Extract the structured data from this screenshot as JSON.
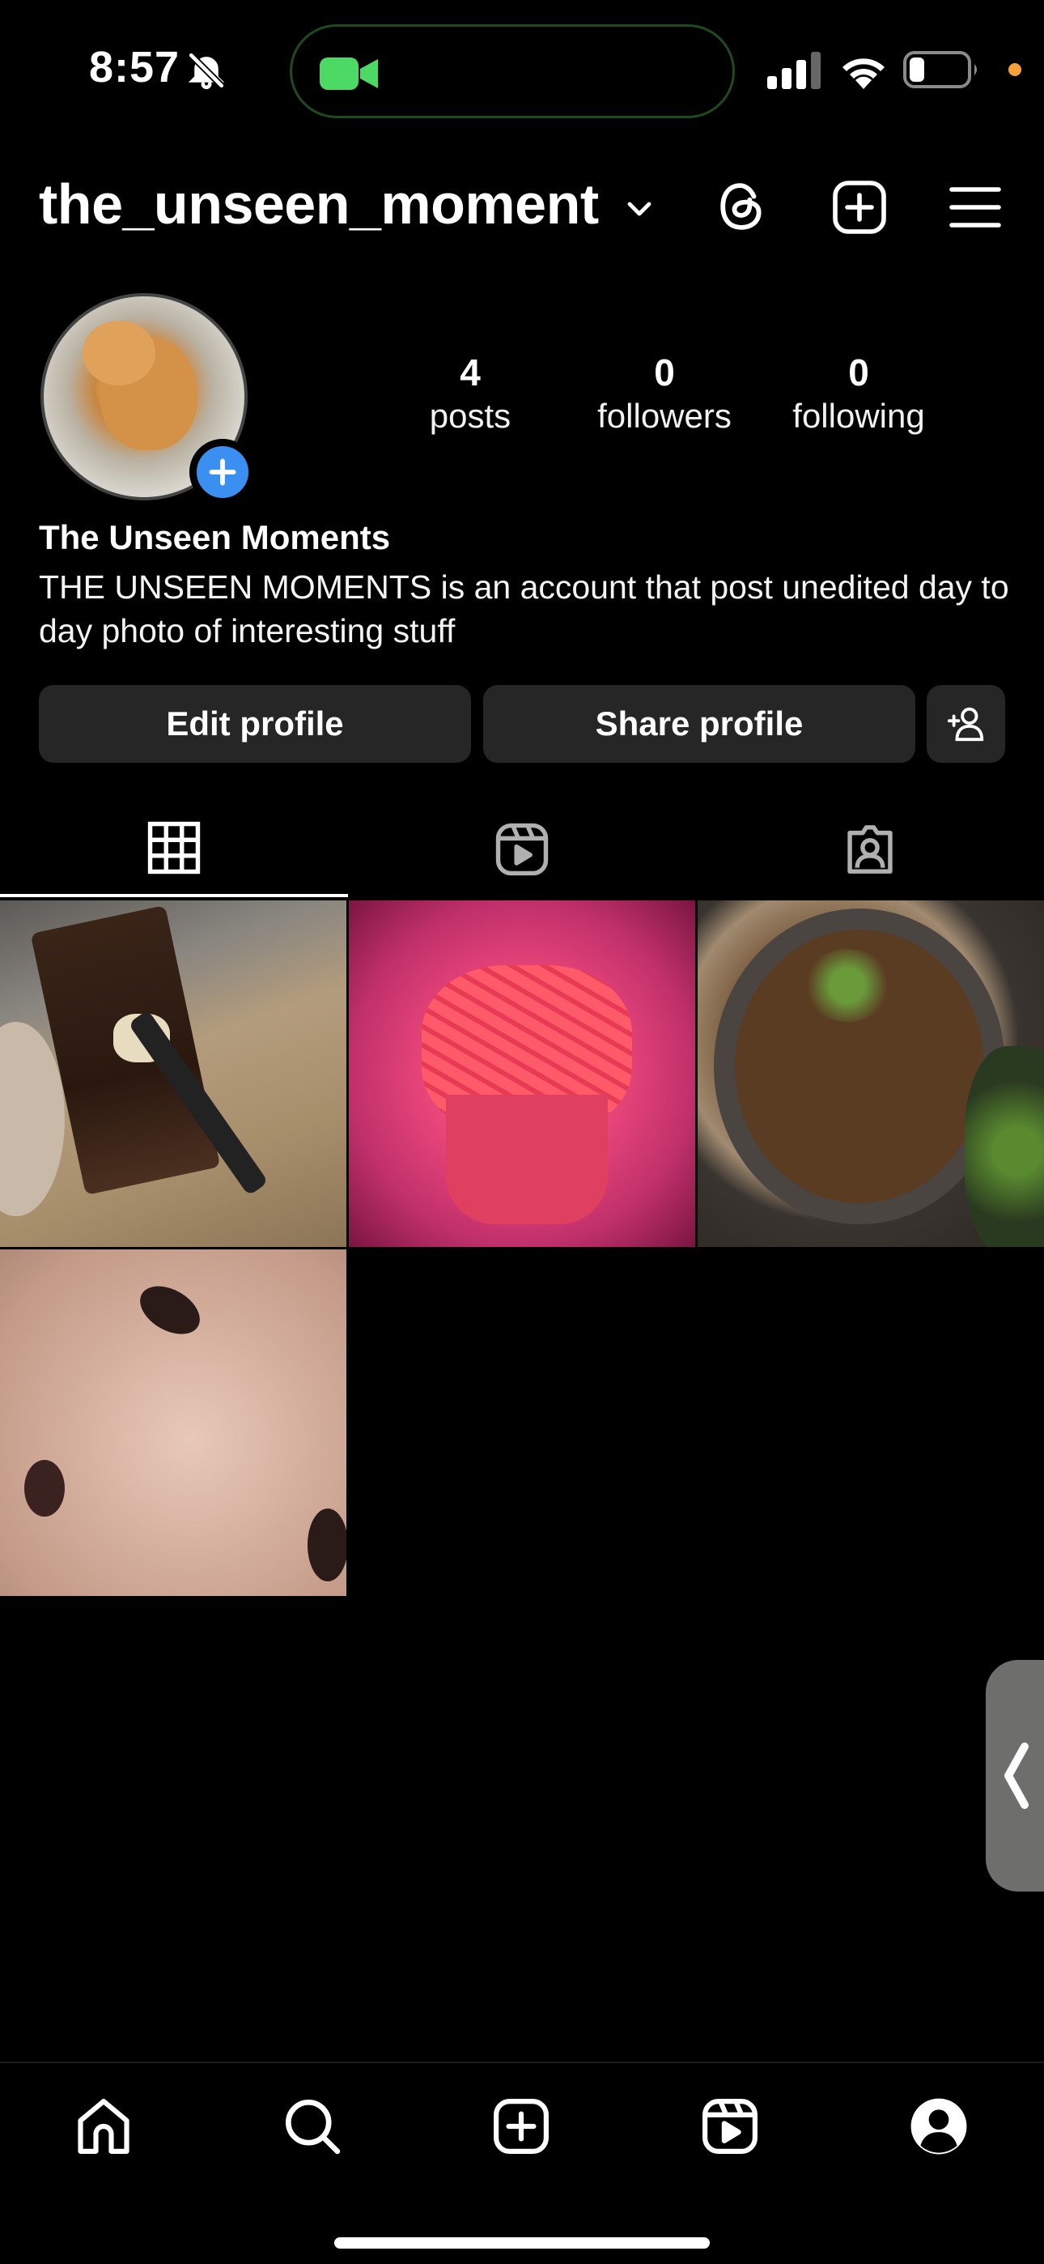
{
  "status_bar": {
    "time": "8:57",
    "icons": [
      "bell-slash-icon",
      "facetime-video-icon",
      "cellular-signal-icon",
      "wifi-icon",
      "battery-icon"
    ]
  },
  "header": {
    "username": "the_unseen_moment",
    "icons": [
      "chevron-down-icon",
      "threads-icon",
      "create-post-icon",
      "menu-icon"
    ]
  },
  "profile": {
    "display_name": "The Unseen Moments",
    "bio": "THE UNSEEN MOMENTS is an account that post unedited day to day photo of interesting stuff",
    "stats": [
      {
        "value": "4",
        "label": "posts"
      },
      {
        "value": "0",
        "label": "followers"
      },
      {
        "value": "0",
        "label": "following"
      }
    ]
  },
  "actions": {
    "edit_label": "Edit profile",
    "share_label": "Share profile",
    "discover_icon": "add-person-icon"
  },
  "tabs": [
    {
      "name": "posts-grid",
      "icon": "grid-icon",
      "active": true
    },
    {
      "name": "reels",
      "icon": "reels-icon",
      "active": false
    },
    {
      "name": "tagged",
      "icon": "tagged-person-icon",
      "active": false
    }
  ],
  "posts": [
    {
      "subject": "chocolate cake slice with fork"
    },
    {
      "subject": "fries in pink paper"
    },
    {
      "subject": "braised meat with vegetables"
    },
    {
      "subject": "close-up face"
    }
  ],
  "bottom_nav": [
    "home-icon",
    "search-icon",
    "create-icon",
    "reels-icon",
    "profile-icon"
  ],
  "colors": {
    "background": "#000000",
    "button_bg": "#262626",
    "accent_blue": "#3a8ff0",
    "facetime_green": "#4cd964"
  }
}
